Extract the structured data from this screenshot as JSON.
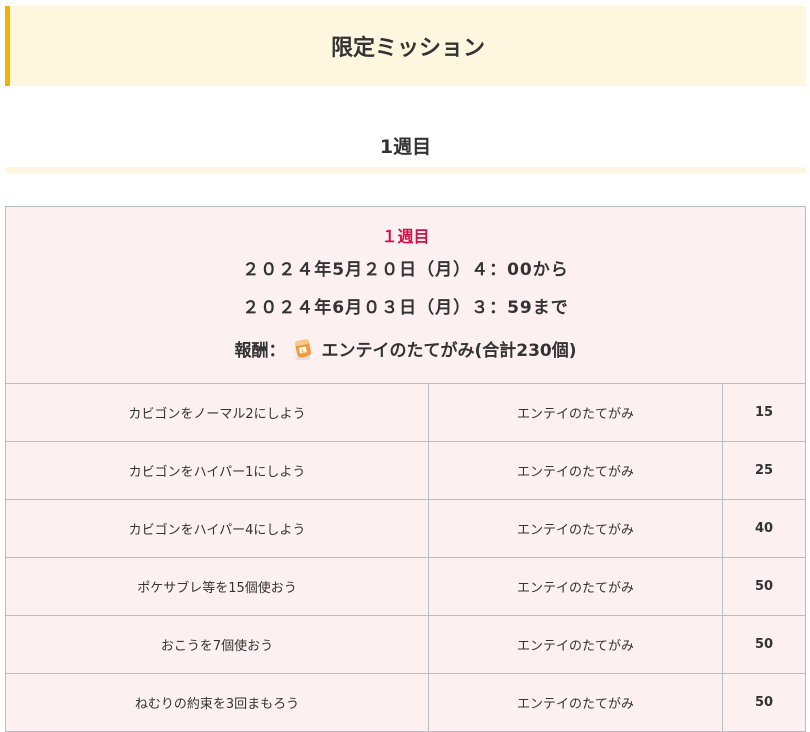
{
  "header": {
    "title": "限定ミッション"
  },
  "section": {
    "heading": "1週目"
  },
  "info": {
    "week_label": "１週目",
    "start": "２０２４年5月２０日（月）４：00から",
    "end": "２０２４年6月０３日（月）３：59まで",
    "reward_prefix": "報酬：",
    "reward_text": "エンテイのたてがみ(合計230個)",
    "reward_icon": "entei-mane-icon"
  },
  "missions": [
    {
      "task": "カビゴンをノーマル2にしよう",
      "reward": "エンテイのたてがみ",
      "count": "15"
    },
    {
      "task": "カビゴンをハイパー1にしよう",
      "reward": "エンテイのたてがみ",
      "count": "25"
    },
    {
      "task": "カビゴンをハイパー4にしよう",
      "reward": "エンテイのたてがみ",
      "count": "40"
    },
    {
      "task": "ポケサブレ等を15個使おう",
      "reward": "エンテイのたてがみ",
      "count": "50"
    },
    {
      "task": "おこうを7個使おう",
      "reward": "エンテイのたてがみ",
      "count": "50"
    },
    {
      "task": "ねむりの約束を3回まもろう",
      "reward": "エンテイのたてがみ",
      "count": "50"
    }
  ],
  "colors": {
    "accent": "#f0b400",
    "header_bg": "#fff6df",
    "table_bg": "#fcf1f0",
    "week_red": "#d31049",
    "border": "#b9bec6"
  }
}
